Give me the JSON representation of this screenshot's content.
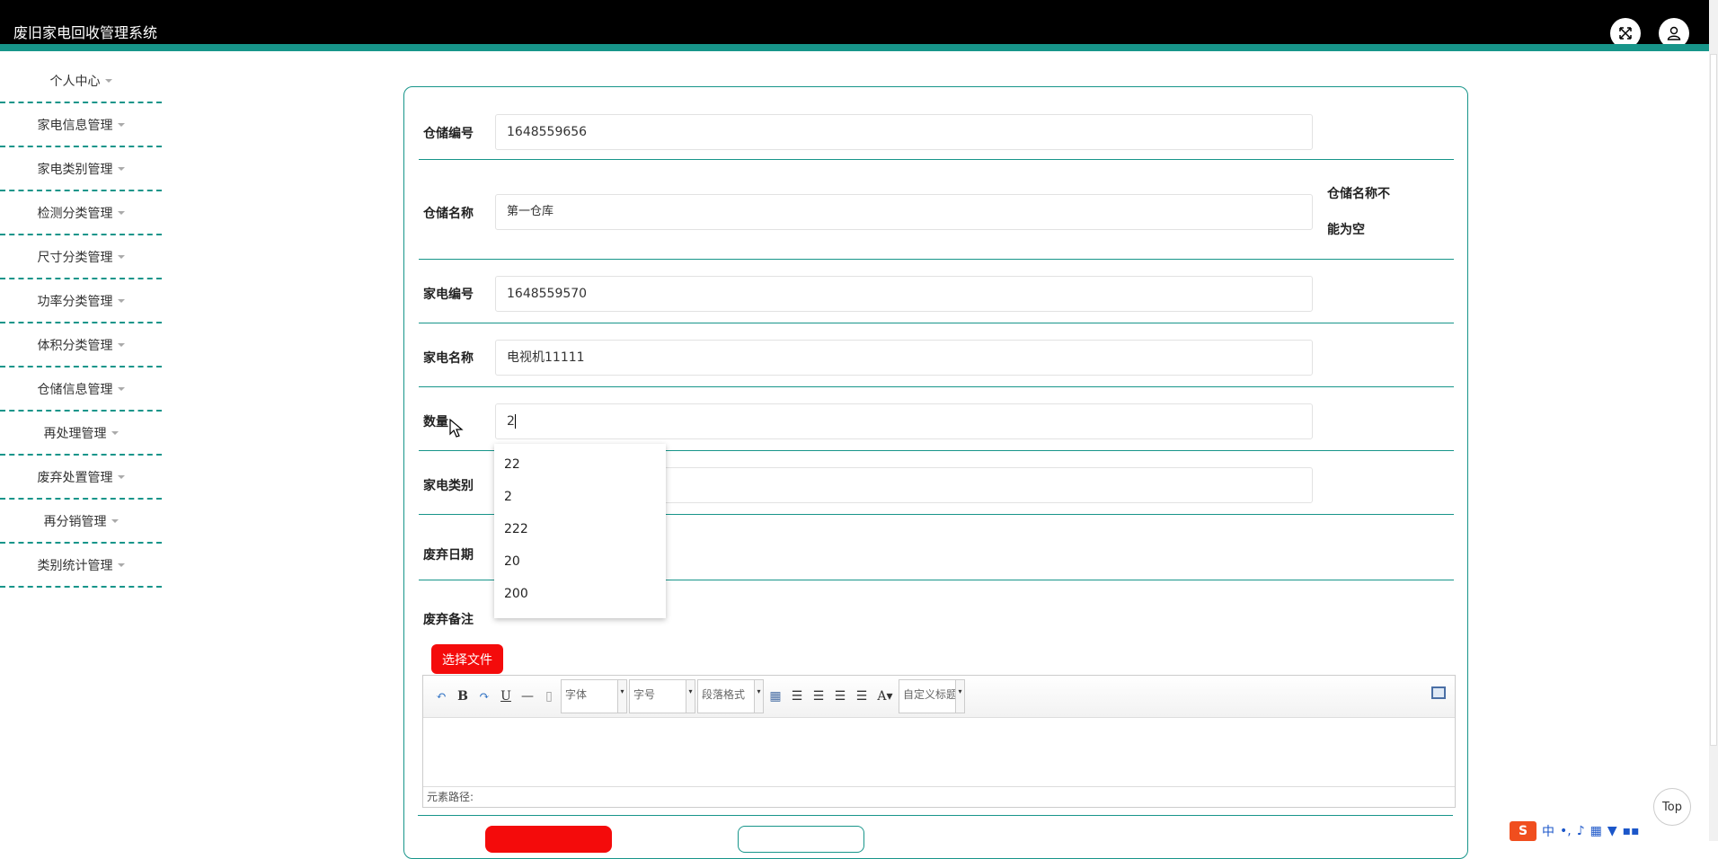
{
  "app": {
    "title": "废旧家电回收管理系统"
  },
  "header": {
    "fullscreen_icon": "expand-icon",
    "user_icon": "user-icon"
  },
  "sidebar": {
    "items": [
      {
        "label": "个人中心"
      },
      {
        "label": "家电信息管理"
      },
      {
        "label": "家电类别管理"
      },
      {
        "label": "检测分类管理"
      },
      {
        "label": "尺寸分类管理"
      },
      {
        "label": "功率分类管理"
      },
      {
        "label": "体积分类管理"
      },
      {
        "label": "仓储信息管理"
      },
      {
        "label": "再处理管理"
      },
      {
        "label": "废弃处置管理"
      },
      {
        "label": "再分销管理"
      },
      {
        "label": "类别统计管理"
      }
    ]
  },
  "form": {
    "warehouse_no": {
      "label": "仓储编号",
      "value": "1648559656"
    },
    "warehouse_name": {
      "label": "仓储名称",
      "value": "第一仓库",
      "error_line1": "仓储名称不",
      "error_line2": "能为空"
    },
    "appliance_no": {
      "label": "家电编号",
      "value": "1648559570"
    },
    "appliance_name": {
      "label": "家电名称",
      "value": "电视机11111"
    },
    "quantity": {
      "label": "数量",
      "value": "2"
    },
    "category": {
      "label": "家电类别",
      "value": ""
    },
    "discard_date": {
      "label": "废弃日期"
    },
    "discard_note": {
      "label": "废弃备注"
    },
    "file_button": "选择文件"
  },
  "autocomplete": {
    "options": [
      "22",
      "2",
      "222",
      "20",
      "200"
    ]
  },
  "editor": {
    "font_label": "字体",
    "size_label": "字号",
    "para_label": "段落格式",
    "custom_title_label": "自定义标题",
    "path_label": "元素路径:"
  },
  "back_to_top": "Top",
  "ime": {
    "logo": "S",
    "mode": "中"
  }
}
